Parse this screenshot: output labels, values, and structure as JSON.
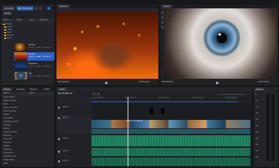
{
  "toolbar": {
    "import_label": "Import",
    "buttons": [
      "Import",
      "Composite",
      "Edit",
      "Export"
    ]
  },
  "media_panel": {
    "tab": "Media",
    "columns": [
      "Name",
      "Date",
      "Type",
      "Duration"
    ],
    "folders": [
      "Project",
      "Audio",
      "Video",
      "Stock",
      "Scenes",
      "Extra"
    ],
    "items": [
      {
        "name": "Candle",
        "info": "1920 × 1080 • 00:00:25"
      },
      {
        "name": "Sunset",
        "info": "1920 × 1080 • 00:00:15"
      },
      {
        "name": "Fireworks",
        "info": "1920 × 1080 • 00:00:20"
      },
      {
        "name": "Eye",
        "info": "1920 × 1080 • 00:00:10"
      }
    ]
  },
  "trimmer": {
    "tab": "Trimmer",
    "timecode_left": "00:00:00;00",
    "timecode_right": "00:00:12;03"
  },
  "viewer": {
    "tab": "Viewer",
    "timecode_left": "00:00:00;00",
    "timecode_right": "00:00:12;03"
  },
  "effects_panel": {
    "tabs": [
      "Effects",
      "Controls",
      "History",
      "Editor"
    ],
    "list": [
      "Audio Filters",
      "Alpha Channel",
      "Blurs",
      "Color Correction",
      "Color Grading",
      "Distort",
      "Generators",
      "Gradients & Fills",
      "Grunge",
      "Keying",
      "Lights & Flares",
      "Particles",
      "Quick 3D",
      "Sharpen",
      "Stylize",
      "Temporal",
      "Transitions",
      "Transitions 3D",
      "Video Filters",
      "Warp"
    ]
  },
  "timeline": {
    "tab": "Editor",
    "timecode": "00:00:08;14",
    "ruler": [
      "00:00:00;00",
      "00:00:05;00",
      "00:00:10;00",
      "00:00:15;00",
      "00:00:20;00"
    ],
    "tracks": [
      {
        "name": "Video 2"
      },
      {
        "name": "Video 1"
      },
      {
        "name": "Audio 1"
      },
      {
        "name": "Audio 2"
      },
      {
        "name": "Audio 3"
      }
    ],
    "clip_label": "Flight of the Birds"
  },
  "meter_panel": {
    "tab": "Meters",
    "scale": [
      "0",
      "-6",
      "-12",
      "-18",
      "-24",
      "-30",
      "-36",
      "-42",
      "-48",
      "-54",
      "-60"
    ]
  },
  "colors": {
    "accent": "#2e6fd8",
    "video_clip": "#3a8a9e",
    "audio_clip": "#1d7a5a",
    "timeline_bar": "#2b3ca0"
  }
}
